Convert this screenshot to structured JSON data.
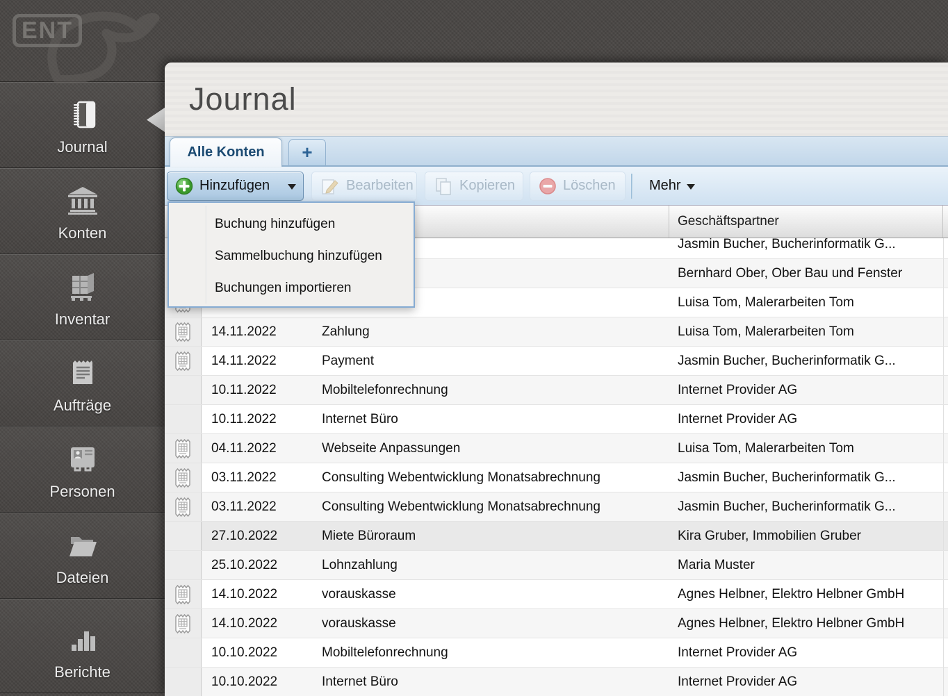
{
  "sidebar": {
    "logo_text": "ENT",
    "items": [
      {
        "label": "Journal",
        "active": true
      },
      {
        "label": "Konten",
        "active": false
      },
      {
        "label": "Inventar",
        "active": false
      },
      {
        "label": "Aufträge",
        "active": false
      },
      {
        "label": "Personen",
        "active": false
      },
      {
        "label": "Dateien",
        "active": false
      },
      {
        "label": "Berichte",
        "active": false
      }
    ]
  },
  "window": {
    "title": "Journal",
    "tabs": {
      "active_tab": "Alle Konten",
      "new_tab": "+"
    },
    "toolbar": {
      "add": "Hinzufügen",
      "edit": "Bearbeiten",
      "copy": "Kopieren",
      "delete": "Löschen",
      "more": "Mehr"
    },
    "menu": {
      "items": [
        "Buchung hinzufügen",
        "Sammelbuchung hinzufügen",
        "Buchungen importieren"
      ]
    },
    "table": {
      "partner_header": "Geschäftspartner",
      "rows": [
        {
          "date": "",
          "description": "",
          "partner": "Jasmin Bucher, Bucherinformatik G...",
          "receipt": false,
          "highlight": false
        },
        {
          "date": "",
          "description": "",
          "partner": "Bernhard Ober, Ober Bau und Fenster",
          "receipt": false,
          "highlight": false
        },
        {
          "date": "",
          "description": "",
          "partner": "Luisa Tom, Malerarbeiten Tom",
          "receipt": true,
          "highlight": false
        },
        {
          "date": "14.11.2022",
          "description": "Zahlung",
          "partner": "Luisa Tom, Malerarbeiten Tom",
          "receipt": true,
          "highlight": false
        },
        {
          "date": "14.11.2022",
          "description": "Payment",
          "partner": "Jasmin Bucher, Bucherinformatik G...",
          "receipt": true,
          "highlight": false
        },
        {
          "date": "10.11.2022",
          "description": "Mobiltelefonrechnung",
          "partner": "Internet Provider AG",
          "receipt": false,
          "highlight": false
        },
        {
          "date": "10.11.2022",
          "description": "Internet Büro",
          "partner": "Internet Provider AG",
          "receipt": false,
          "highlight": false
        },
        {
          "date": "04.11.2022",
          "description": "Webseite Anpassungen",
          "partner": "Luisa Tom, Malerarbeiten Tom",
          "receipt": true,
          "highlight": false
        },
        {
          "date": "03.11.2022",
          "description": "Consulting Webentwicklung Monatsabrechnung",
          "partner": "Jasmin Bucher, Bucherinformatik G...",
          "receipt": true,
          "highlight": false
        },
        {
          "date": "03.11.2022",
          "description": "Consulting Webentwicklung Monatsabrechnung",
          "partner": "Jasmin Bucher, Bucherinformatik G...",
          "receipt": true,
          "highlight": false
        },
        {
          "date": "27.10.2022",
          "description": "Miete Büroraum",
          "partner": "Kira Gruber, Immobilien Gruber",
          "receipt": false,
          "highlight": true
        },
        {
          "date": "25.10.2022",
          "description": "Lohnzahlung",
          "partner": "Maria Muster",
          "receipt": false,
          "highlight": false
        },
        {
          "date": "14.10.2022",
          "description": "vorauskasse",
          "partner": "Agnes Helbner, Elektro Helbner GmbH",
          "receipt": true,
          "highlight": false
        },
        {
          "date": "14.10.2022",
          "description": "vorauskasse",
          "partner": "Agnes Helbner, Elektro Helbner GmbH",
          "receipt": true,
          "highlight": false
        },
        {
          "date": "10.10.2022",
          "description": "Mobiltelefonrechnung",
          "partner": "Internet Provider AG",
          "receipt": false,
          "highlight": false
        },
        {
          "date": "10.10.2022",
          "description": "Internet Büro",
          "partner": "Internet Provider AG",
          "receipt": false,
          "highlight": false
        }
      ]
    }
  },
  "colors": {
    "accent_blue": "#6d92b4",
    "tab_text": "#1b4a72",
    "add_green": "#3fa32f",
    "delete_red": "#e07f7f",
    "sidebar_bg": "#4a4745",
    "highlight_row": "#e9e9e9"
  }
}
